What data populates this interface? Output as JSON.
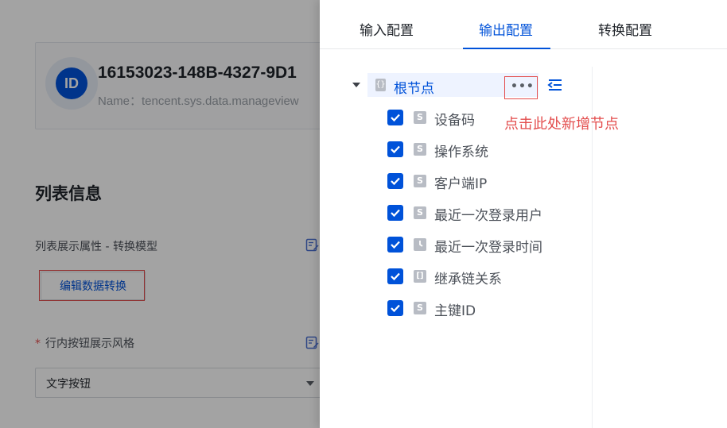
{
  "background": {
    "id_card": {
      "avatar_text": "ID",
      "title": "16153023-148B-4327-9D1",
      "subtitle": "Name：tencent.sys.data.manageview"
    },
    "section_title": "列表信息",
    "list_prop_label": "列表展示属性 - 转换模型",
    "edit_button_label": "编辑数据转换",
    "inline_style_required": "*",
    "inline_style_label": "行内按钮展示风格",
    "style_select_value": "文字按钮"
  },
  "drawer": {
    "tabs": [
      {
        "label": "输入配置",
        "active": false
      },
      {
        "label": "输出配置",
        "active": true
      },
      {
        "label": "转换配置",
        "active": false
      }
    ],
    "root_node": {
      "icon_text": "{}",
      "label": "根节点",
      "more_label": "•••"
    },
    "annotation": "点击此处新增节点",
    "fields": [
      {
        "type": "S",
        "label": "设备码",
        "checked": true
      },
      {
        "type": "S",
        "label": "操作系统",
        "checked": true
      },
      {
        "type": "S",
        "label": "客户端IP",
        "checked": true
      },
      {
        "type": "S",
        "label": "最近一次登录用户",
        "checked": true
      },
      {
        "type": "clock",
        "label": "最近一次登录时间",
        "checked": true
      },
      {
        "type": "[]",
        "label": "继承链关系",
        "checked": true
      },
      {
        "type": "S",
        "label": "主键ID",
        "checked": true
      }
    ]
  },
  "colors": {
    "accent": "#0052d9",
    "annotation_red": "#e34d4d",
    "overlay": "rgba(0,0,0,0.36)"
  }
}
